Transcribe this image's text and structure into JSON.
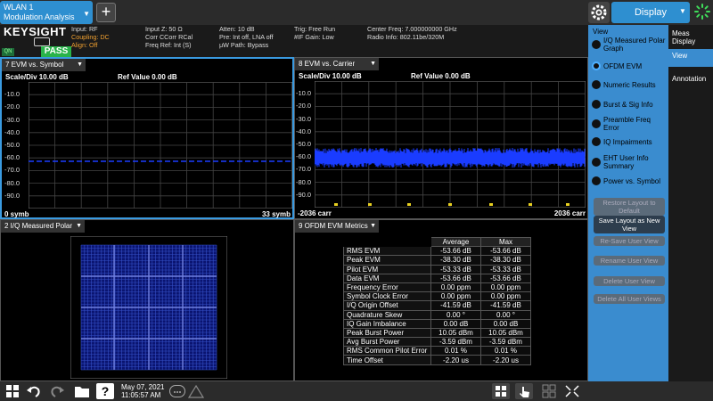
{
  "top": {
    "mode_line1": "WLAN 1",
    "mode_line2": "Modulation Analysis",
    "add_label": "+",
    "display_label": "Display"
  },
  "status": {
    "logo": "KEYSIGHT",
    "q_badge": "QN",
    "pass": "PASS",
    "input": "Input: RF",
    "coupling": "Coupling: DC",
    "align": "Align: Off",
    "input_z": "Input Z: 50 Ω",
    "corr": "Corr CCorr RCal",
    "freq_ref": "Freq Ref: Int (S)",
    "atten": "Atten: 10 dB",
    "pre": "Pre: Int off, LNA off",
    "uw_path": "μW Path: Bypass",
    "trig": "Trig: Free Run",
    "if_gain": "#IF Gain: Low",
    "center_freq": "Center Freq: 7.000000000 GHz",
    "radio_info": "Radio Info: 802.11be/320M"
  },
  "pane7": {
    "title": "7 EVM vs. Symbol",
    "scale": "Scale/Div 10.00 dB",
    "ref": "Ref Value 0.00 dB",
    "x_start": "0 symb",
    "x_end": "33 symb",
    "yticks": [
      "-10.0",
      "-20.0",
      "-30.0",
      "-40.0",
      "-50.0",
      "-60.0",
      "-70.0",
      "-80.0",
      "-90.0"
    ]
  },
  "pane8": {
    "title": "8 EVM vs. Carrier",
    "scale": "Scale/Div 10.00 dB",
    "ref": "Ref Value 0.00 dB",
    "x_start": "-2036 carr",
    "x_end": "2036 carr",
    "yticks": [
      "-10.0",
      "-20.0",
      "-30.0",
      "-40.0",
      "-50.0",
      "-60.0",
      "-70.0",
      "-80.0",
      "-90.0"
    ]
  },
  "pane2": {
    "title": "2 I/Q Measured Polar"
  },
  "pane9": {
    "title": "9 OFDM EVM Metrics",
    "col_average": "Average",
    "col_max": "Max",
    "rows": [
      {
        "label": "RMS EVM",
        "avg": "-53.66 dB",
        "max": "-53.66 dB"
      },
      {
        "label": "Peak EVM",
        "avg": "-38.30 dB",
        "max": "-38.30 dB"
      },
      {
        "label": "Pilot EVM",
        "avg": "-53.33 dB",
        "max": "-53.33 dB"
      },
      {
        "label": "Data EVM",
        "avg": "-53.66 dB",
        "max": "-53.66 dB"
      },
      {
        "label": "Frequency Error",
        "avg": "0.00 ppm",
        "max": "0.00 ppm"
      },
      {
        "label": "Symbol Clock Error",
        "avg": "0.00 ppm",
        "max": "0.00 ppm"
      },
      {
        "label": "I/Q Origin Offset",
        "avg": "-41.59 dB",
        "max": "-41.59 dB"
      },
      {
        "label": "Quadrature Skew",
        "avg": "0.00 °",
        "max": "0.00 °"
      },
      {
        "label": "IQ Gain Imbalance",
        "avg": "0.00 dB",
        "max": "0.00 dB"
      },
      {
        "label": "Peak Burst Power",
        "avg": "10.05 dBm",
        "max": "10.05 dBm"
      },
      {
        "label": "Avg Burst Power",
        "avg": "-3.59 dBm",
        "max": "-3.59 dBm"
      },
      {
        "label": "RMS Common Pilot Error",
        "avg": "0.01 %",
        "max": "0.01 %"
      },
      {
        "label": "Time Offset",
        "avg": "-2.20 us",
        "max": "-2.20 us"
      }
    ]
  },
  "view_panel": {
    "title": "View",
    "options": [
      {
        "label": "I/Q Measured Polar Graph",
        "selected": false
      },
      {
        "label": "OFDM EVM",
        "selected": true
      },
      {
        "label": "Numeric Results",
        "selected": false
      },
      {
        "label": "Burst & Sig Info",
        "selected": false
      },
      {
        "label": "Preamble Freq Error",
        "selected": false
      },
      {
        "label": "IQ Impairments",
        "selected": false
      },
      {
        "label": "EHT User Info Summary",
        "selected": false
      },
      {
        "label": "Power vs. Symbol",
        "selected": false
      }
    ],
    "restore_layout": "Restore Layout to Default",
    "save_layout": "Save Layout as New View",
    "resave_view": "Re-Save User View",
    "rename_view": "Rename User View",
    "delete_view": "Delete User View",
    "delete_all": "Delete All User Views"
  },
  "tabs": {
    "meas_display": "Meas Display",
    "view": "View",
    "annotation": "Annotation"
  },
  "taskbar": {
    "date": "May 07, 2021",
    "time": "11:05:57 AM"
  },
  "colors": {
    "accent": "#3a8ccf",
    "trace": "#1a3cff",
    "pass": "#29b34a"
  }
}
